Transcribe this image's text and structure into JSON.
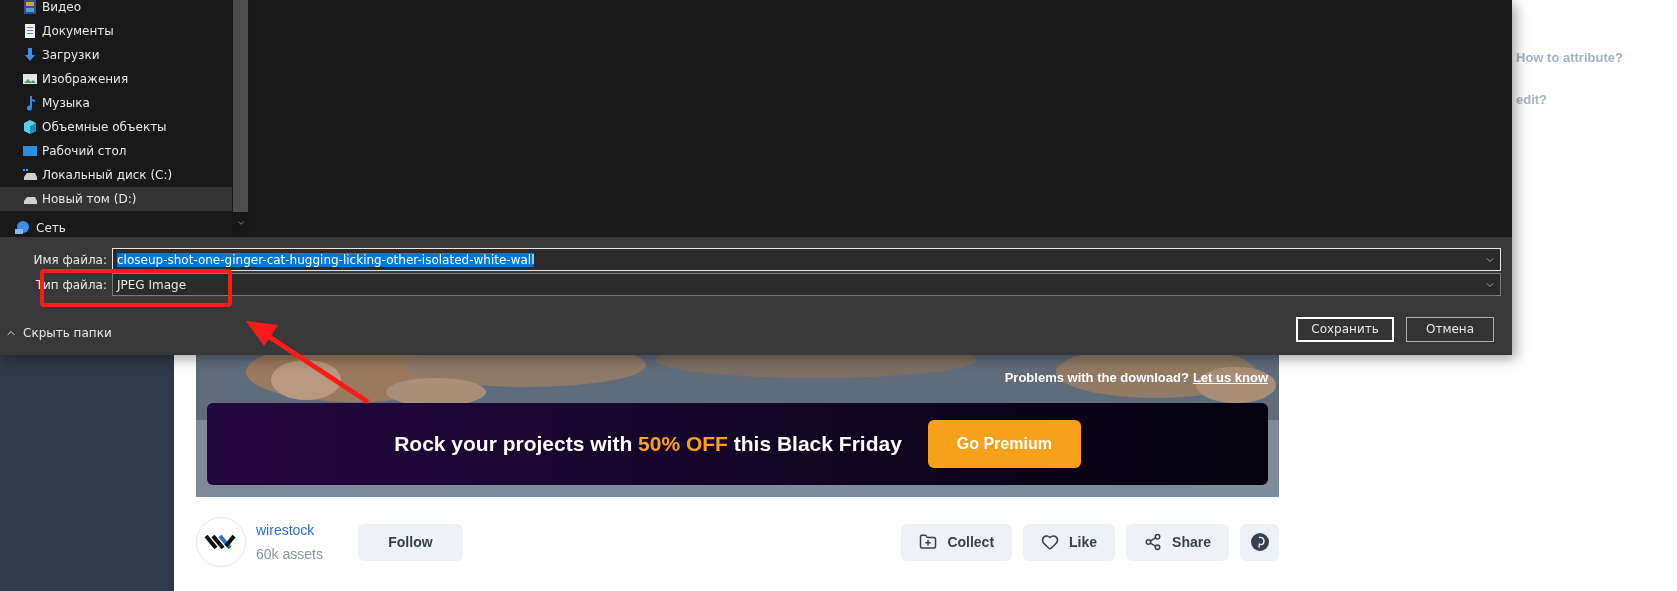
{
  "dialog": {
    "nav_items": [
      {
        "label": "Видео",
        "selected": false
      },
      {
        "label": "Документы",
        "selected": false
      },
      {
        "label": "Загрузки",
        "selected": false
      },
      {
        "label": "Изображения",
        "selected": false
      },
      {
        "label": "Музыка",
        "selected": false
      },
      {
        "label": "Объемные объекты",
        "selected": false
      },
      {
        "label": "Рабочий стол",
        "selected": false
      },
      {
        "label": "Локальный диск (C:)",
        "selected": false
      },
      {
        "label": "Новый том (D:)",
        "selected": true
      }
    ],
    "network_item": {
      "label": "Сеть"
    },
    "file_name": {
      "label": "Имя файла:",
      "value": "closeup-shot-one-ginger-cat-hugging-licking-other-isolated-white-wall",
      "selected": true
    },
    "file_type": {
      "label": "Тип файла:",
      "value": "JPEG Image"
    },
    "hide_folders": "Скрыть папки",
    "buttons": [
      {
        "label": "Сохранить",
        "default": true
      },
      {
        "label": "Отмена",
        "default": false
      }
    ]
  },
  "page": {
    "side_links": [
      "How to attribute?",
      "edit?"
    ],
    "download_help": {
      "text": "Problems with the download?",
      "link": "Let us know"
    },
    "promo": {
      "parts": [
        {
          "text": "Rock your projects with ",
          "highlight": false
        },
        {
          "text": "50% OFF",
          "highlight": true
        },
        {
          "text": " this Black Friday",
          "highlight": false
        }
      ],
      "button": "Go Premium"
    },
    "author": {
      "name": "wirestock",
      "assets": "60k assets",
      "follow": "Follow"
    },
    "actions": [
      {
        "label": "Collect"
      },
      {
        "label": "Like"
      },
      {
        "label": "Share"
      }
    ]
  }
}
